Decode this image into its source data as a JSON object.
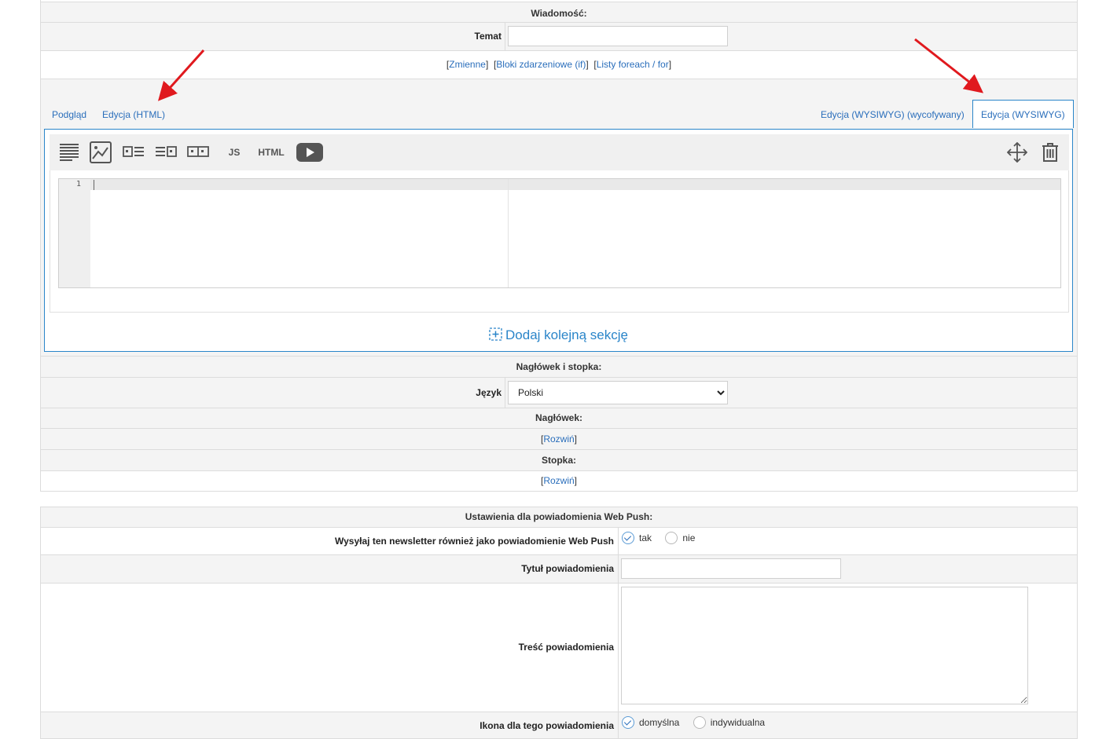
{
  "message_section": {
    "header": "Wiadomość:",
    "subject_label": "Temat",
    "subject_value": "",
    "links": {
      "variables": "Zmienne",
      "event_blocks": "Bloki zdarzeniowe (if)",
      "foreach_lists": "Listy foreach / for"
    }
  },
  "tabs": {
    "preview": "Podgląd",
    "edit_html": "Edycja (HTML)",
    "wysiwyg_deprecated": "Edycja (WYSIWYG) (wycofywany)",
    "wysiwyg": "Edycja (WYSIWYG)",
    "active": "wysiwyg"
  },
  "editor": {
    "toolbar": {
      "js_label": "JS",
      "html_label": "HTML",
      "icons": [
        "text-block-icon",
        "image-icon",
        "image-left-text-icon",
        "text-image-right-icon",
        "two-images-icon",
        "js-icon",
        "html-icon",
        "video-icon",
        "move-icon",
        "trash-icon"
      ]
    },
    "code_line_number": "1",
    "code_content": "",
    "add_section_label": "Dodaj kolejną sekcję"
  },
  "header_footer": {
    "header": "Nagłówek i stopka:",
    "language_label": "Język",
    "language_value": "Polski",
    "header_label": "Nagłówek:",
    "footer_label": "Stopka:",
    "expand_label": "Rozwiń"
  },
  "webpush": {
    "header": "Ustawienia dla powiadomienia Web Push:",
    "send_label": "Wysyłaj ten newsletter również jako powiadomienie Web Push",
    "send_yes": "tak",
    "send_no": "nie",
    "send_selected": "tak",
    "title_label": "Tytuł powiadomienia",
    "title_value": "",
    "body_label": "Treść powiadomienia",
    "body_value": "",
    "icon_label": "Ikona dla tego powiadomienia",
    "icon_default": "domyślna",
    "icon_custom": "indywidualna",
    "icon_selected": "domyślna"
  },
  "colors": {
    "link": "#2a6ebb",
    "accent_border": "#2a85c9",
    "annotation_arrow": "#e0191e",
    "row_grey": "#f4f4f4"
  }
}
